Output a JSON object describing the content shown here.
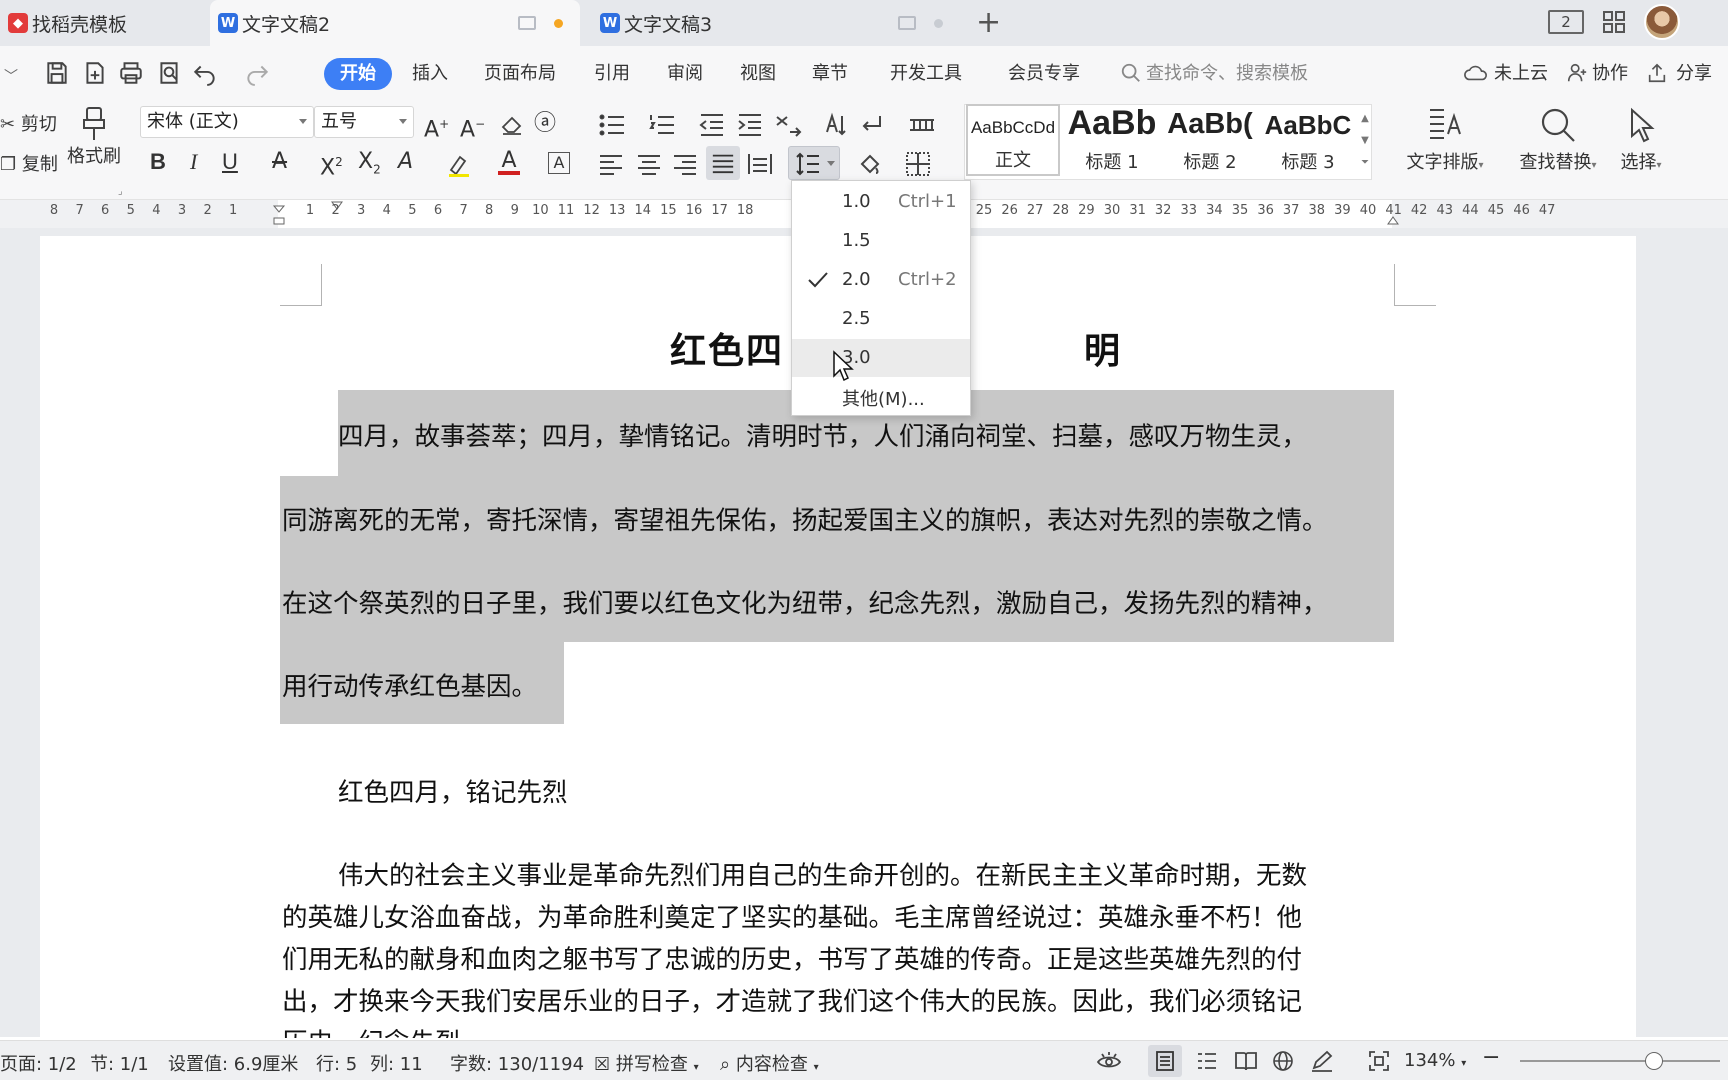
{
  "tabs": [
    {
      "label": "找稻壳模板",
      "icon": "docer-icon"
    },
    {
      "label": "文字文稿2",
      "icon": "wps-writer-icon",
      "active": true
    },
    {
      "label": "文字文稿3",
      "icon": "wps-writer-icon"
    }
  ],
  "top_right": {
    "badge": "2"
  },
  "menu": {
    "items": [
      "开始",
      "插入",
      "页面布局",
      "引用",
      "审阅",
      "视图",
      "章节",
      "开发工具",
      "会员专享"
    ],
    "search_placeholder": "查找命令、搜索模板",
    "cloud": "未上云",
    "collab": "协作",
    "share": "分享"
  },
  "ribbon": {
    "cut": "剪切",
    "copy": "复制",
    "format_painter": "格式刷",
    "font_name": "宋体 (正文)",
    "font_size": "五号",
    "styles": [
      {
        "preview": "AaBbCcDd",
        "label": "正文"
      },
      {
        "preview": "AaBb",
        "label": "标题 1"
      },
      {
        "preview": "AaBb(",
        "label": "标题 2"
      },
      {
        "preview": "AaBbC",
        "label": "标题 3"
      }
    ],
    "text_layout": "文字排版",
    "find_replace": "查找替换",
    "select": "选择"
  },
  "ruler": {
    "left_numbers": [
      "8",
      "7",
      "6",
      "5",
      "4",
      "3",
      "2",
      "1"
    ],
    "right_numbers": [
      "1",
      "2",
      "3",
      "4",
      "5",
      "6",
      "7",
      "8",
      "9",
      "10",
      "11",
      "12",
      "13",
      "14",
      "15",
      "16",
      "17",
      "18"
    ],
    "far_numbers": [
      "25",
      "26",
      "27",
      "28",
      "29",
      "30",
      "31",
      "32",
      "33",
      "34",
      "35",
      "36",
      "37",
      "38",
      "39",
      "40",
      "41",
      "42",
      "43",
      "44",
      "45",
      "46",
      "47"
    ]
  },
  "document": {
    "title_left": "红色四",
    "title_right": "明",
    "lines": [
      "四月，故事荟萃；四月，挚情铭记。清明时节，人们涌向祠堂、扫墓，感叹万物生灵，",
      "同游离死的无常，寄托深情，寄望祖先保佑，扬起爱国主义的旗帜，表达对先烈的崇敬之情。",
      "在这个祭英烈的日子里，我们要以红色文化为纽带，纪念先烈，激励自己，发扬先烈的精神，",
      "用行动传承红色基因。"
    ],
    "subtitle": "红色四月，铭记先烈",
    "para2": [
      "伟大的社会主义事业是革命先烈们用自己的生命开创的。在新民主主义革命时期，无数",
      "的英雄儿女浴血奋战，为革命胜利奠定了坚实的基础。毛主席曾经说过：英雄永垂不朽！他",
      "们用无私的献身和血肉之躯书写了忠诚的历史，书写了英雄的传奇。正是这些英雄先烈的付",
      "出，才换来今天我们安居乐业的日子，才造就了我们这个伟大的民族。因此，我们必须铭记",
      "历史，纪念先烈"
    ]
  },
  "line_spacing_menu": {
    "items": [
      {
        "value": "1.0",
        "shortcut": "Ctrl+1"
      },
      {
        "value": "1.5",
        "shortcut": ""
      },
      {
        "value": "2.0",
        "shortcut": "Ctrl+2",
        "checked": true
      },
      {
        "value": "2.5",
        "shortcut": ""
      },
      {
        "value": "3.0",
        "shortcut": "",
        "hovered": true
      }
    ],
    "other": "其他(M)..."
  },
  "status": {
    "page": "页面: 1/2",
    "section": "节: 1/1",
    "setting": "设置值: 6.9厘米",
    "row": "行: 5",
    "col": "列: 11",
    "wordcount": "字数: 130/1194",
    "spellcheck": "拼写检查",
    "content_check": "内容检查",
    "zoom": "134%",
    "zoom_level": 0.67
  },
  "colors": {
    "accent": "#3d7ff5",
    "wps_red": "#e23b3b",
    "selection": "#c8c8c8",
    "font_color_bar": "#d02020"
  }
}
